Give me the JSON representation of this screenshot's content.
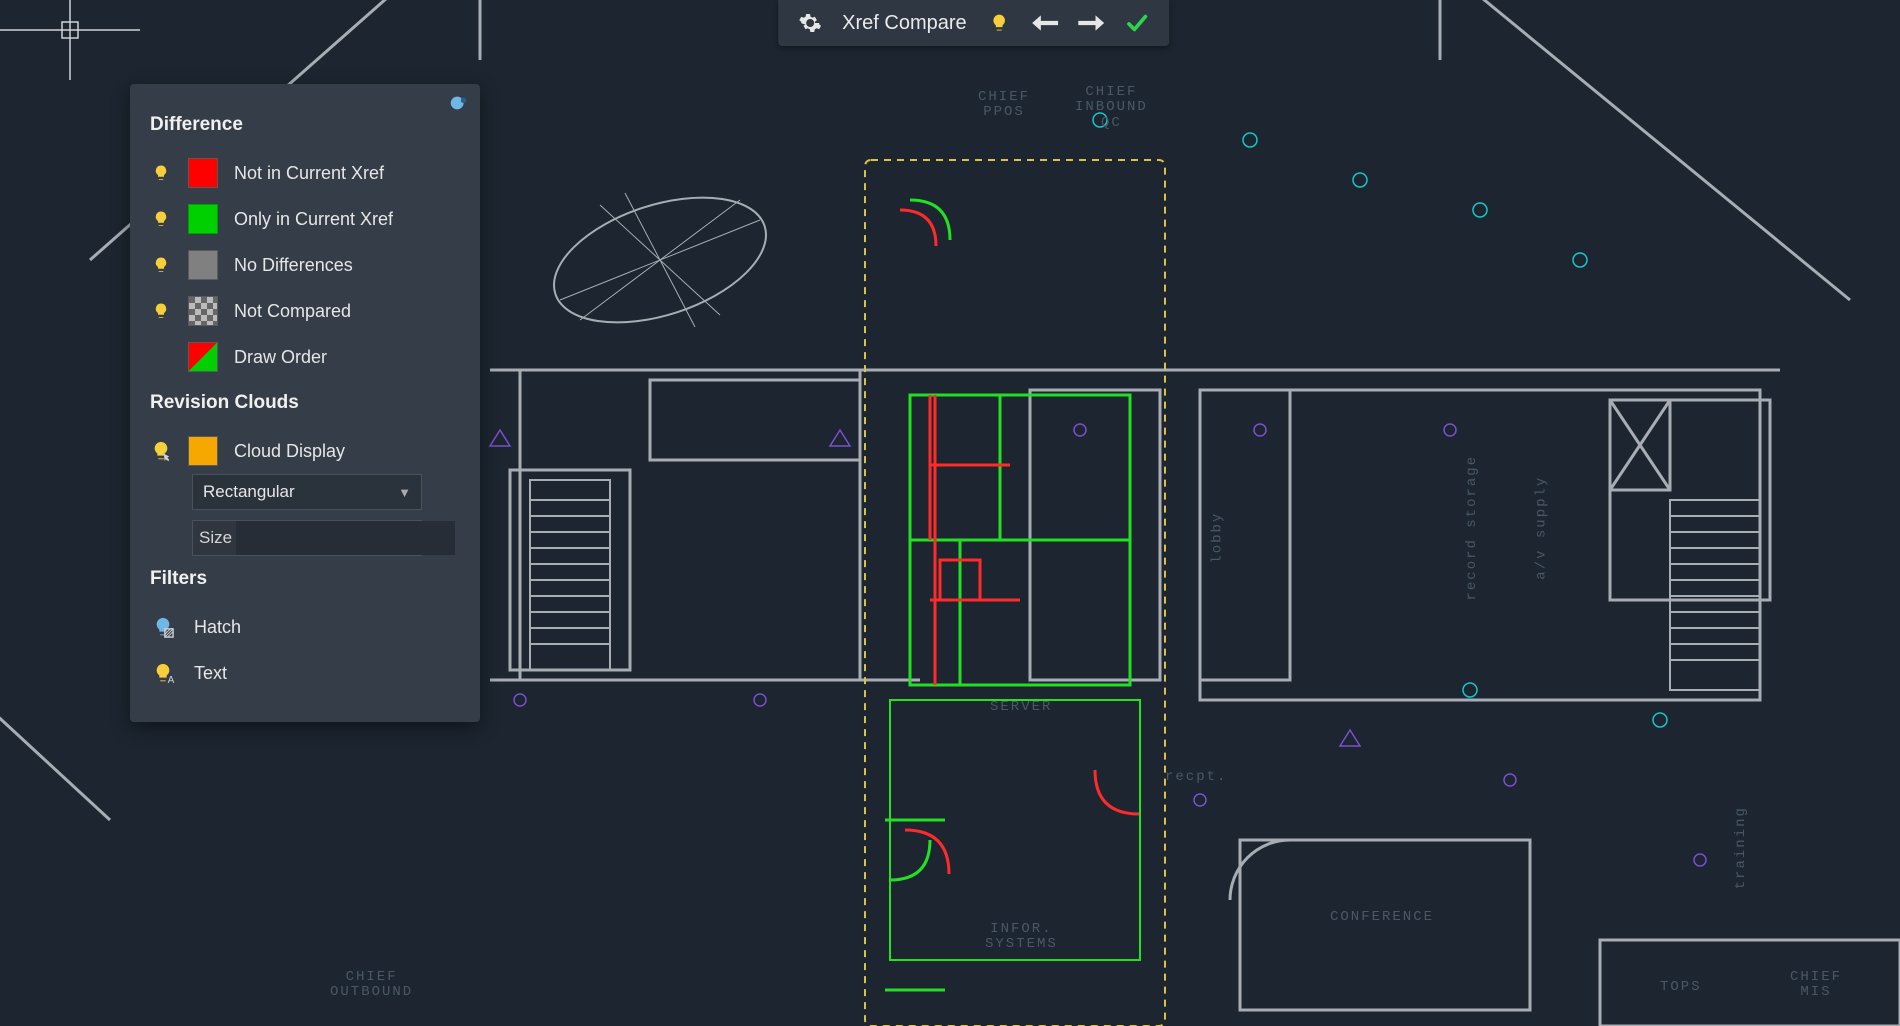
{
  "toolbar": {
    "title": "Xref Compare"
  },
  "panel": {
    "sections": {
      "difference": {
        "title": "Difference",
        "items": [
          {
            "label": "Not in Current Xref"
          },
          {
            "label": "Only in Current Xref"
          },
          {
            "label": "No Differences"
          },
          {
            "label": "Not Compared"
          },
          {
            "label": "Draw Order"
          }
        ]
      },
      "revision_clouds": {
        "title": "Revision Clouds",
        "cloud_display_label": "Cloud Display",
        "shape_selected": "Rectangular",
        "size_label": "Size",
        "size_value": ""
      },
      "filters": {
        "title": "Filters",
        "hatch_label": "Hatch",
        "text_label": "Text"
      }
    }
  },
  "rooms": {
    "chief_ppos": "CHIEF\nPPOS",
    "chief_inbound_qc": "CHIEF\nINBOUND\nQC",
    "server": "SERVER",
    "infor_systems": "INFOR.\nSYSTEMS",
    "recpt": "recpt.",
    "lobby": "lobby",
    "record_storage": "record storage",
    "av_supply": "a/v supply",
    "conference": "CONFERENCE",
    "tops": "TOPS",
    "chief_mis": "CHIEF\nMIS",
    "training": "training",
    "chief_outbound": "CHIEF\nOUTBOUND"
  }
}
